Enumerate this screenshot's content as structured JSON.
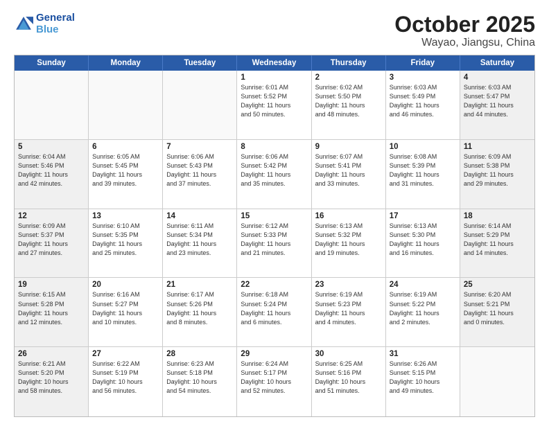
{
  "header": {
    "logo_line1": "General",
    "logo_line2": "Blue",
    "title": "October 2025",
    "subtitle": "Wayao, Jiangsu, China"
  },
  "weekdays": [
    "Sunday",
    "Monday",
    "Tuesday",
    "Wednesday",
    "Thursday",
    "Friday",
    "Saturday"
  ],
  "weeks": [
    [
      {
        "day": "",
        "info": "",
        "empty": true
      },
      {
        "day": "",
        "info": "",
        "empty": true
      },
      {
        "day": "",
        "info": "",
        "empty": true
      },
      {
        "day": "1",
        "info": "Sunrise: 6:01 AM\nSunset: 5:52 PM\nDaylight: 11 hours\nand 50 minutes.",
        "shaded": false
      },
      {
        "day": "2",
        "info": "Sunrise: 6:02 AM\nSunset: 5:50 PM\nDaylight: 11 hours\nand 48 minutes.",
        "shaded": false
      },
      {
        "day": "3",
        "info": "Sunrise: 6:03 AM\nSunset: 5:49 PM\nDaylight: 11 hours\nand 46 minutes.",
        "shaded": false
      },
      {
        "day": "4",
        "info": "Sunrise: 6:03 AM\nSunset: 5:47 PM\nDaylight: 11 hours\nand 44 minutes.",
        "shaded": true
      }
    ],
    [
      {
        "day": "5",
        "info": "Sunrise: 6:04 AM\nSunset: 5:46 PM\nDaylight: 11 hours\nand 42 minutes.",
        "shaded": true
      },
      {
        "day": "6",
        "info": "Sunrise: 6:05 AM\nSunset: 5:45 PM\nDaylight: 11 hours\nand 39 minutes.",
        "shaded": false
      },
      {
        "day": "7",
        "info": "Sunrise: 6:06 AM\nSunset: 5:43 PM\nDaylight: 11 hours\nand 37 minutes.",
        "shaded": false
      },
      {
        "day": "8",
        "info": "Sunrise: 6:06 AM\nSunset: 5:42 PM\nDaylight: 11 hours\nand 35 minutes.",
        "shaded": false
      },
      {
        "day": "9",
        "info": "Sunrise: 6:07 AM\nSunset: 5:41 PM\nDaylight: 11 hours\nand 33 minutes.",
        "shaded": false
      },
      {
        "day": "10",
        "info": "Sunrise: 6:08 AM\nSunset: 5:39 PM\nDaylight: 11 hours\nand 31 minutes.",
        "shaded": false
      },
      {
        "day": "11",
        "info": "Sunrise: 6:09 AM\nSunset: 5:38 PM\nDaylight: 11 hours\nand 29 minutes.",
        "shaded": true
      }
    ],
    [
      {
        "day": "12",
        "info": "Sunrise: 6:09 AM\nSunset: 5:37 PM\nDaylight: 11 hours\nand 27 minutes.",
        "shaded": true
      },
      {
        "day": "13",
        "info": "Sunrise: 6:10 AM\nSunset: 5:35 PM\nDaylight: 11 hours\nand 25 minutes.",
        "shaded": false
      },
      {
        "day": "14",
        "info": "Sunrise: 6:11 AM\nSunset: 5:34 PM\nDaylight: 11 hours\nand 23 minutes.",
        "shaded": false
      },
      {
        "day": "15",
        "info": "Sunrise: 6:12 AM\nSunset: 5:33 PM\nDaylight: 11 hours\nand 21 minutes.",
        "shaded": false
      },
      {
        "day": "16",
        "info": "Sunrise: 6:13 AM\nSunset: 5:32 PM\nDaylight: 11 hours\nand 19 minutes.",
        "shaded": false
      },
      {
        "day": "17",
        "info": "Sunrise: 6:13 AM\nSunset: 5:30 PM\nDaylight: 11 hours\nand 16 minutes.",
        "shaded": false
      },
      {
        "day": "18",
        "info": "Sunrise: 6:14 AM\nSunset: 5:29 PM\nDaylight: 11 hours\nand 14 minutes.",
        "shaded": true
      }
    ],
    [
      {
        "day": "19",
        "info": "Sunrise: 6:15 AM\nSunset: 5:28 PM\nDaylight: 11 hours\nand 12 minutes.",
        "shaded": true
      },
      {
        "day": "20",
        "info": "Sunrise: 6:16 AM\nSunset: 5:27 PM\nDaylight: 11 hours\nand 10 minutes.",
        "shaded": false
      },
      {
        "day": "21",
        "info": "Sunrise: 6:17 AM\nSunset: 5:26 PM\nDaylight: 11 hours\nand 8 minutes.",
        "shaded": false
      },
      {
        "day": "22",
        "info": "Sunrise: 6:18 AM\nSunset: 5:24 PM\nDaylight: 11 hours\nand 6 minutes.",
        "shaded": false
      },
      {
        "day": "23",
        "info": "Sunrise: 6:19 AM\nSunset: 5:23 PM\nDaylight: 11 hours\nand 4 minutes.",
        "shaded": false
      },
      {
        "day": "24",
        "info": "Sunrise: 6:19 AM\nSunset: 5:22 PM\nDaylight: 11 hours\nand 2 minutes.",
        "shaded": false
      },
      {
        "day": "25",
        "info": "Sunrise: 6:20 AM\nSunset: 5:21 PM\nDaylight: 11 hours\nand 0 minutes.",
        "shaded": true
      }
    ],
    [
      {
        "day": "26",
        "info": "Sunrise: 6:21 AM\nSunset: 5:20 PM\nDaylight: 10 hours\nand 58 minutes.",
        "shaded": true
      },
      {
        "day": "27",
        "info": "Sunrise: 6:22 AM\nSunset: 5:19 PM\nDaylight: 10 hours\nand 56 minutes.",
        "shaded": false
      },
      {
        "day": "28",
        "info": "Sunrise: 6:23 AM\nSunset: 5:18 PM\nDaylight: 10 hours\nand 54 minutes.",
        "shaded": false
      },
      {
        "day": "29",
        "info": "Sunrise: 6:24 AM\nSunset: 5:17 PM\nDaylight: 10 hours\nand 52 minutes.",
        "shaded": false
      },
      {
        "day": "30",
        "info": "Sunrise: 6:25 AM\nSunset: 5:16 PM\nDaylight: 10 hours\nand 51 minutes.",
        "shaded": false
      },
      {
        "day": "31",
        "info": "Sunrise: 6:26 AM\nSunset: 5:15 PM\nDaylight: 10 hours\nand 49 minutes.",
        "shaded": false
      },
      {
        "day": "",
        "info": "",
        "empty": true,
        "shaded": true
      }
    ]
  ]
}
